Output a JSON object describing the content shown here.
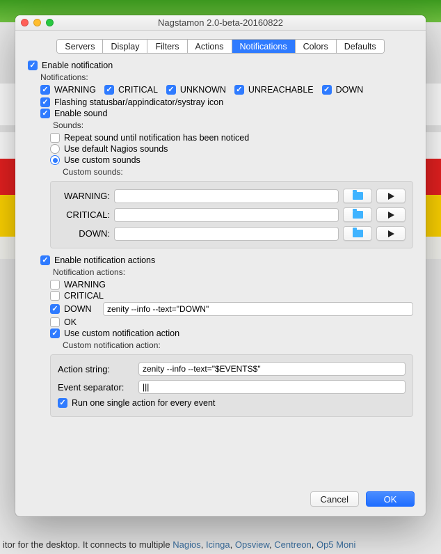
{
  "window": {
    "title": "Nagstamon 2.0-beta-20160822"
  },
  "tabs": [
    "Servers",
    "Display",
    "Filters",
    "Actions",
    "Notifications",
    "Colors",
    "Defaults"
  ],
  "active_tab": "Notifications",
  "enable_notification": "Enable notification",
  "notifications_label": "Notifications:",
  "flags": {
    "warning": "WARNING",
    "critical": "CRITICAL",
    "unknown": "UNKNOWN",
    "unreachable": "UNREACHABLE",
    "down": "DOWN"
  },
  "flashing": "Flashing statusbar/appindicator/systray icon",
  "enable_sound": "Enable sound",
  "sounds_label": "Sounds:",
  "repeat_sound": "Repeat sound until notification has been noticed",
  "default_sounds": "Use default Nagios sounds",
  "custom_sounds": "Use custom sounds",
  "custom_sounds_label": "Custom sounds:",
  "sound_rows": {
    "warning": "WARNING:",
    "critical": "CRITICAL:",
    "down": "DOWN:"
  },
  "enable_actions": "Enable notification actions",
  "actions_label": "Notification actions:",
  "act_warning": "WARNING",
  "act_critical": "CRITICAL",
  "act_down": "DOWN",
  "act_down_cmd": "zenity --info --text=\"DOWN\"",
  "act_ok": "OK",
  "use_custom_action": "Use custom notification action",
  "custom_action_label": "Custom notification action:",
  "action_string_label": "Action string:",
  "action_string_val": "zenity --info --text=\"$EVENTS$\"",
  "event_sep_label": "Event separator:",
  "event_sep_val": "|||",
  "run_single": "Run one single action for every event",
  "buttons": {
    "cancel": "Cancel",
    "ok": "OK"
  },
  "bg_text_pre": "itor for the desktop. It connects to multiple ",
  "bg_links": [
    "Nagios",
    "Icinga",
    "Opsview",
    "Centreon",
    "Op5 Moni"
  ]
}
